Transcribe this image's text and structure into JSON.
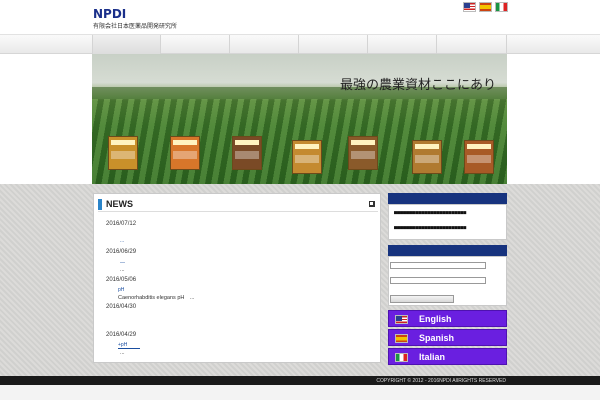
{
  "header": {
    "logo": "NPDI",
    "company": "有限会社日本医薬品開発研究所",
    "flags": [
      {
        "name": "us-flag-icon",
        "label": "English"
      },
      {
        "name": "spain-flag-icon",
        "label": "Spanish"
      },
      {
        "name": "italy-flag-icon",
        "label": "Italian"
      }
    ]
  },
  "hero": {
    "caption": "最強の農業資材ここにあり"
  },
  "news": {
    "title": "NEWS",
    "items": [
      {
        "date": "2016/07/12",
        "link": "...",
        "text": ""
      },
      {
        "date": "2016/06/29",
        "link": "—",
        "text": "..."
      },
      {
        "date": "2016/05/06",
        "link": "pH",
        "text": "Caenorhabditis elegans pH　..."
      },
      {
        "date": "2016/04/30",
        "link": "",
        "text": ""
      },
      {
        "date": "2016/04/29",
        "link": "+pH",
        "text": "..."
      }
    ]
  },
  "sidebar": {
    "hash_line_1": "■■■■■■■■■■■■■■■■■■■■■■■■",
    "hash_line_2": "■■■■■■■■■■■■■■■■■■■■■■■■"
  },
  "languages": [
    {
      "label": "English",
      "flag": "us-flag-icon"
    },
    {
      "label": "Spanish",
      "flag": "spain-flag-icon"
    },
    {
      "label": "Italian",
      "flag": "italy-flag-icon"
    }
  ],
  "footer": {
    "copyright": "COPYRIGHT © 2012 - 2016NPDI  AIIRIGHTS RESERVED"
  }
}
